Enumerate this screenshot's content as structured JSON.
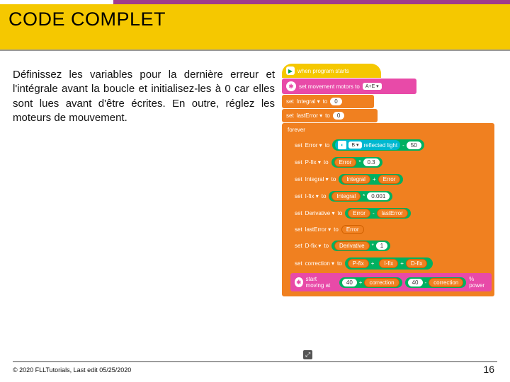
{
  "colors": {
    "purple": "#a03c8c",
    "yellow": "#f5c800",
    "orange": "#f08020",
    "pink": "#e84aa8",
    "green": "#00b060",
    "teal": "#00b8d0"
  },
  "title": "CODE COMPLET",
  "body_text": "Définissez les variables pour la dernière erreur et l'intégrale avant la boucle et initialisez-les à 0 car elles sont lues avant d'être écrites.    En outre, réglez les moteurs de mouvement.",
  "code": {
    "hat": "when program starts",
    "set_motors_label": "set movement motors to",
    "set_motors_ports": "A+E ▾",
    "set_word": "set",
    "to_word": "to",
    "init": [
      {
        "var": "Integral ▾",
        "val": "0"
      },
      {
        "var": "lastError ▾",
        "val": "0"
      }
    ],
    "forever_label": "forever",
    "loop": {
      "lines": [
        {
          "var": "Error ▾",
          "rhs_type": "op_minus",
          "left_sensor": {
            "port": "B ▾",
            "attr": "reflected light"
          },
          "right_num": "50"
        },
        {
          "var": "P-fix ▾",
          "rhs_type": "op_times",
          "left_var": "Error",
          "right_num": "0.3"
        },
        {
          "var": "Integral ▾",
          "rhs_type": "op_plus",
          "left_var": "Integral",
          "right_var": "Error"
        },
        {
          "var": "I-fix ▾",
          "rhs_type": "op_times",
          "left_var": "Integral",
          "right_num": "0.001"
        },
        {
          "var": "Derivative ▾",
          "rhs_type": "op_minus_vv",
          "left_var": "Error",
          "right_var": "lastError"
        },
        {
          "var": "lastError ▾",
          "rhs_type": "var",
          "single_var": "Error"
        },
        {
          "var": "D-fix ▾",
          "rhs_type": "op_times",
          "left_var": "Derivative",
          "right_num": "1"
        },
        {
          "var": "correction ▾",
          "rhs_type": "triple_sum",
          "a": "P-fix",
          "b": "I-fix",
          "c": "D-fix"
        }
      ],
      "move": {
        "label": "start moving at",
        "base_left": "40",
        "corr": "correction",
        "base_right": "40",
        "suffix": "% power"
      }
    }
  },
  "footer": {
    "left": "© 2020 FLLTutorials, Last edit 05/25/2020",
    "page": "16"
  }
}
